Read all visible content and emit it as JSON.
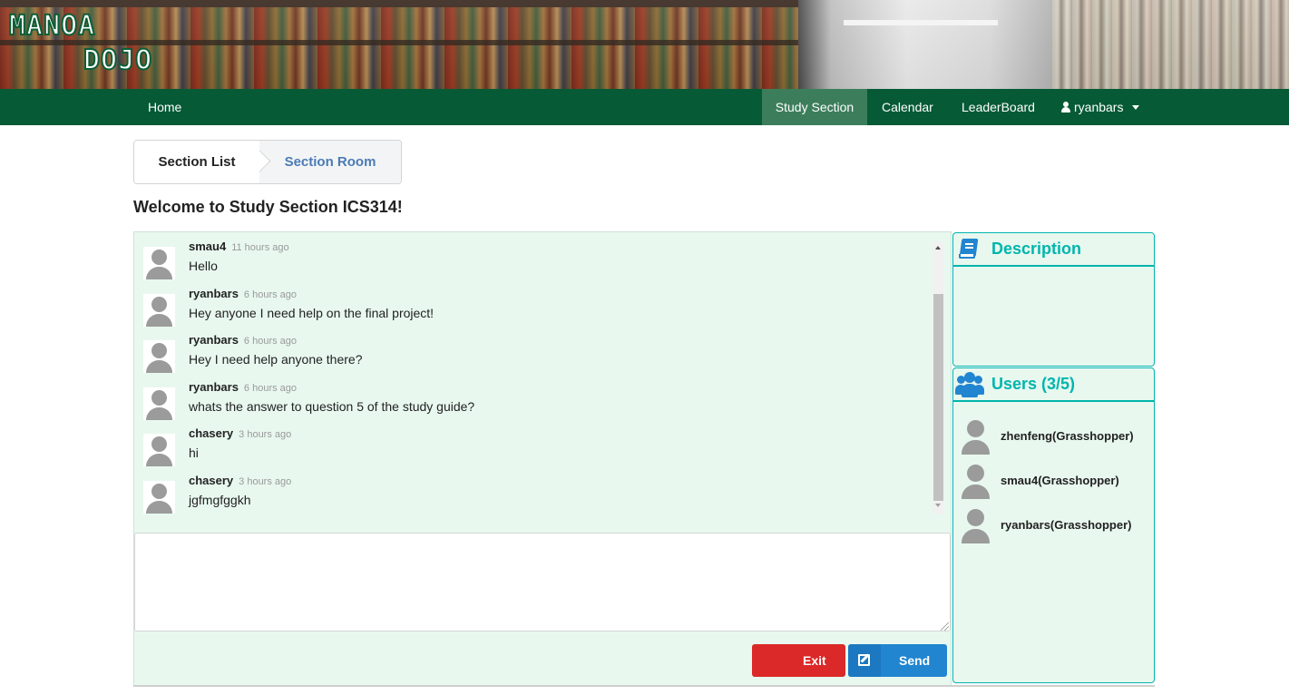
{
  "logo": {
    "line1": "MANOA",
    "line2": "DOJO"
  },
  "nav": {
    "home": "Home",
    "study_section": "Study Section",
    "calendar": "Calendar",
    "leaderboard": "LeaderBoard",
    "user": "ryanbars"
  },
  "steps": {
    "list": "Section List",
    "room": "Section Room"
  },
  "welcome": "Welcome to Study Section ICS314!",
  "messages": [
    {
      "author": "smau4",
      "time": "11 hours ago",
      "text": "Hello"
    },
    {
      "author": "ryanbars",
      "time": "6 hours ago",
      "text": "Hey anyone I need help on the final project!"
    },
    {
      "author": "ryanbars",
      "time": "6 hours ago",
      "text": "Hey I need help anyone there?"
    },
    {
      "author": "ryanbars",
      "time": "6 hours ago",
      "text": "whats the answer to question 5 of the study guide?"
    },
    {
      "author": "chasery",
      "time": "3 hours ago",
      "text": "hi"
    },
    {
      "author": "chasery",
      "time": "3 hours ago",
      "text": "jgfmgfggkh"
    }
  ],
  "compose": {
    "value": ""
  },
  "buttons": {
    "exit": "Exit",
    "send": "Send"
  },
  "sidebar": {
    "description": {
      "title": "Description",
      "body": ""
    },
    "users": {
      "title": "Users (3/5)",
      "list": [
        "zhenfeng(Grasshopper)",
        "smau4(Grasshopper)",
        "ryanbars(Grasshopper)"
      ]
    }
  },
  "colors": {
    "navbar": "#065a35",
    "nav_active": "#3c7e5c",
    "panel_bg": "#e8f8ef",
    "teal_accent": "#00b5ad",
    "exit_red": "#db2828",
    "send_blue": "#2185d0"
  },
  "icons": [
    "user-icon",
    "caret-down-icon",
    "edit-icon",
    "book-icon",
    "users-icon",
    "avatar-icon"
  ]
}
